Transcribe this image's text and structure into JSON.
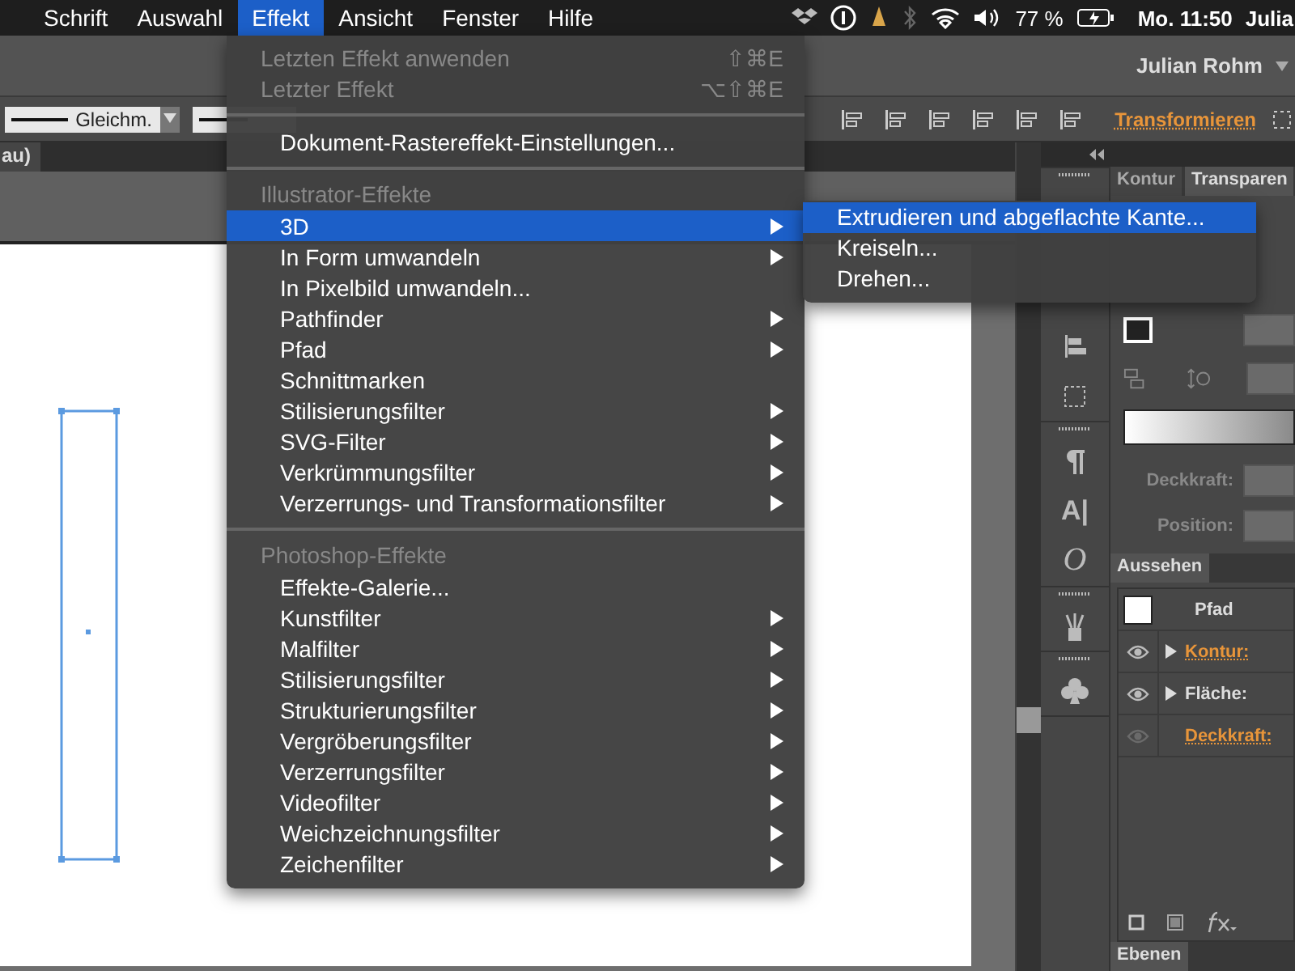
{
  "menu_bar": {
    "items": [
      {
        "label": "Schrift",
        "selected": false
      },
      {
        "label": "Auswahl",
        "selected": false
      },
      {
        "label": "Effekt",
        "selected": true
      },
      {
        "label": "Ansicht",
        "selected": false
      },
      {
        "label": "Fenster",
        "selected": false
      },
      {
        "label": "Hilfe",
        "selected": false
      }
    ],
    "battery": "77 %",
    "clock": "Mo. 11:50",
    "user": "Julia"
  },
  "app_bar": {
    "user": "Julian Rohm"
  },
  "control_bar": {
    "stroke_profile": "Gleichm.",
    "link": "Transformieren"
  },
  "document_tab": {
    "title": "au)"
  },
  "toolstrip": {
    "character_glyph": "A|",
    "opentype_glyph": "O"
  },
  "effekt_menu": {
    "items": [
      {
        "kind": "item",
        "label": "Letzten Effekt anwenden",
        "shortcut": "⇧⌘E",
        "disabled": true,
        "has_submenu": false,
        "selected": false
      },
      {
        "kind": "item",
        "label": "Letzter Effekt",
        "shortcut": "⌥⇧⌘E",
        "disabled": true,
        "has_submenu": false,
        "selected": false
      },
      {
        "kind": "separator"
      },
      {
        "kind": "item",
        "label": "Dokument-Rastereffekt-Einstellungen...",
        "disabled": false,
        "has_submenu": false,
        "selected": false
      },
      {
        "kind": "separator"
      },
      {
        "kind": "header",
        "label": "Illustrator-Effekte"
      },
      {
        "kind": "item",
        "label": "3D",
        "disabled": false,
        "has_submenu": true,
        "selected": true
      },
      {
        "kind": "item",
        "label": "In Form umwandeln",
        "disabled": false,
        "has_submenu": true,
        "selected": false
      },
      {
        "kind": "item",
        "label": "In Pixelbild umwandeln...",
        "disabled": false,
        "has_submenu": false,
        "selected": false
      },
      {
        "kind": "item",
        "label": "Pathfinder",
        "disabled": false,
        "has_submenu": true,
        "selected": false
      },
      {
        "kind": "item",
        "label": "Pfad",
        "disabled": false,
        "has_submenu": true,
        "selected": false
      },
      {
        "kind": "item",
        "label": "Schnittmarken",
        "disabled": false,
        "has_submenu": false,
        "selected": false
      },
      {
        "kind": "item",
        "label": "Stilisierungsfilter",
        "disabled": false,
        "has_submenu": true,
        "selected": false
      },
      {
        "kind": "item",
        "label": "SVG-Filter",
        "disabled": false,
        "has_submenu": true,
        "selected": false
      },
      {
        "kind": "item",
        "label": "Verkrümmungsfilter",
        "disabled": false,
        "has_submenu": true,
        "selected": false
      },
      {
        "kind": "item",
        "label": "Verzerrungs- und Transformationsfilter",
        "disabled": false,
        "has_submenu": true,
        "selected": false
      },
      {
        "kind": "separator"
      },
      {
        "kind": "header",
        "label": "Photoshop-Effekte"
      },
      {
        "kind": "item",
        "label": "Effekte-Galerie...",
        "disabled": false,
        "has_submenu": false,
        "selected": false
      },
      {
        "kind": "item",
        "label": "Kunstfilter",
        "disabled": false,
        "has_submenu": true,
        "selected": false
      },
      {
        "kind": "item",
        "label": "Malfilter",
        "disabled": false,
        "has_submenu": true,
        "selected": false
      },
      {
        "kind": "item",
        "label": "Stilisierungsfilter",
        "disabled": false,
        "has_submenu": true,
        "selected": false
      },
      {
        "kind": "item",
        "label": "Strukturierungsfilter",
        "disabled": false,
        "has_submenu": true,
        "selected": false
      },
      {
        "kind": "item",
        "label": "Vergröberungsfilter",
        "disabled": false,
        "has_submenu": true,
        "selected": false
      },
      {
        "kind": "item",
        "label": "Verzerrungsfilter",
        "disabled": false,
        "has_submenu": true,
        "selected": false
      },
      {
        "kind": "item",
        "label": "Videofilter",
        "disabled": false,
        "has_submenu": true,
        "selected": false
      },
      {
        "kind": "item",
        "label": "Weichzeichnungsfilter",
        "disabled": false,
        "has_submenu": true,
        "selected": false
      },
      {
        "kind": "item",
        "label": "Zeichenfilter",
        "disabled": false,
        "has_submenu": true,
        "selected": false
      }
    ]
  },
  "submenu_3d": {
    "items": [
      {
        "label": "Extrudieren und abgeflachte Kante...",
        "selected": true
      },
      {
        "label": "Kreiseln...",
        "selected": false
      },
      {
        "label": "Drehen...",
        "selected": false
      }
    ]
  },
  "kontur_panel": {
    "tabs": [
      {
        "label": "Kontur",
        "selected": false
      },
      {
        "label": "Transparen",
        "selected": true
      }
    ],
    "opacity_label": "Deckkraft:",
    "position_label": "Position:"
  },
  "aussehen_panel": {
    "tab": "Aussehen",
    "object": "Pfad",
    "rows": [
      {
        "label": "Kontur:",
        "kind": "link",
        "expandable": true,
        "visible": true
      },
      {
        "label": "Fläche:",
        "kind": "plain",
        "expandable": true,
        "visible": true
      },
      {
        "label": "Deckkraft:",
        "kind": "link",
        "expandable": false,
        "visible": false
      }
    ]
  },
  "ebenen_panel": {
    "tab": "Ebenen"
  }
}
